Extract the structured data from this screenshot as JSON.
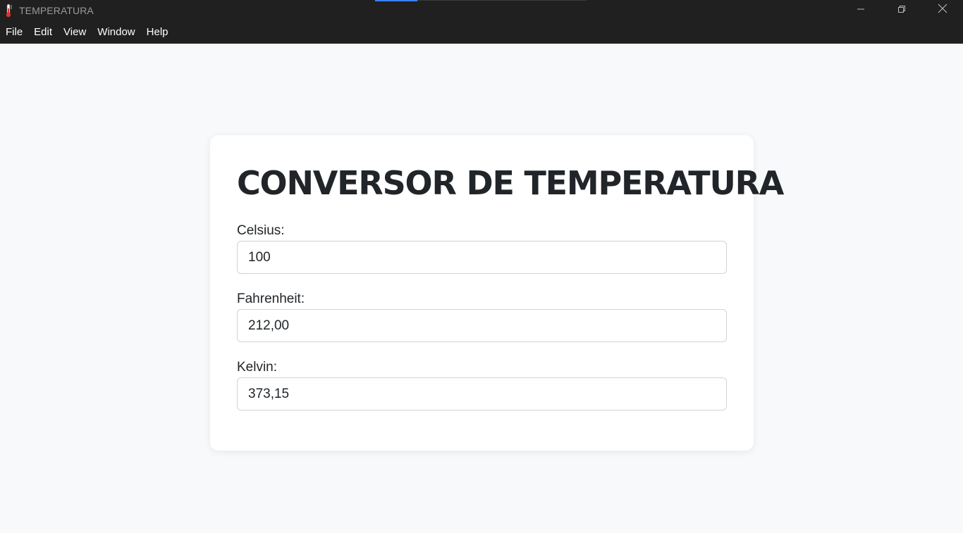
{
  "window": {
    "title": "TEMPERATURA",
    "icon": "thermometer-icon",
    "controls": [
      "minimize-icon",
      "restore-icon",
      "close-icon"
    ]
  },
  "menubar": {
    "items": [
      {
        "label": "File"
      },
      {
        "label": "Edit"
      },
      {
        "label": "View"
      },
      {
        "label": "Window"
      },
      {
        "label": "Help"
      }
    ]
  },
  "main": {
    "heading": "CONVERSOR DE TEMPERATURA",
    "fields": [
      {
        "label": "Celsius:",
        "value": "100"
      },
      {
        "label": "Fahrenheit:",
        "value": "212,00"
      },
      {
        "label": "Kelvin:",
        "value": "373,15"
      }
    ]
  },
  "colors": {
    "titlebar_bg": "#202020",
    "page_bg": "#f8f9fa",
    "card_bg": "#ffffff",
    "text": "#212529",
    "input_border": "#ced4da",
    "thermometer_red": "#e03131"
  }
}
